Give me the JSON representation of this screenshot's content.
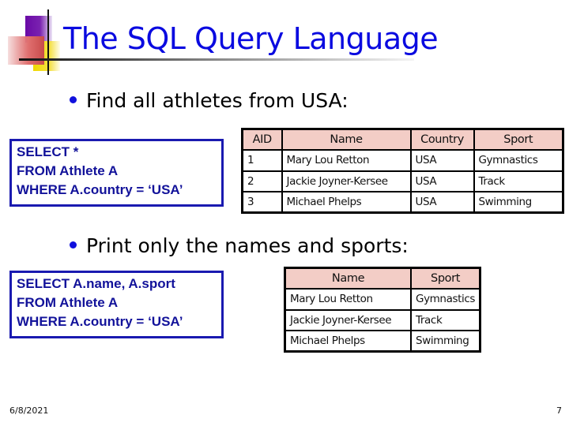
{
  "slide": {
    "title": "The SQL Query Language",
    "date": "6/8/2021",
    "page_number": "7",
    "colors": {
      "title": "#0a0ae0",
      "sql_text": "#12129a",
      "sql_border": "#1a1ab0",
      "table_header_bg": "#f3cdc6",
      "bullet": "#1010dd"
    }
  },
  "sections": [
    {
      "bullet": "Find all athletes from USA:",
      "sql": [
        "SELECT *",
        "FROM Athlete A",
        "WHERE A.country = ‘USA’"
      ],
      "result": {
        "columns": [
          "AID",
          "Name",
          "Country",
          "Sport"
        ],
        "rows": [
          [
            "1",
            "Mary Lou Retton",
            "USA",
            "Gymnastics"
          ],
          [
            "2",
            "Jackie Joyner-Kersee",
            "USA",
            "Track"
          ],
          [
            "3",
            "Michael Phelps",
            "USA",
            "Swimming"
          ]
        ]
      }
    },
    {
      "bullet": "Print only the names and sports:",
      "sql": [
        "SELECT A.name, A.sport",
        "FROM Athlete A",
        "WHERE A.country = ‘USA’"
      ],
      "result": {
        "columns": [
          "Name",
          "Sport"
        ],
        "rows": [
          [
            "Mary Lou Retton",
            "Gymnastics"
          ],
          [
            "Jackie Joyner-Kersee",
            "Track"
          ],
          [
            "Michael Phelps",
            "Swimming"
          ]
        ]
      }
    }
  ]
}
